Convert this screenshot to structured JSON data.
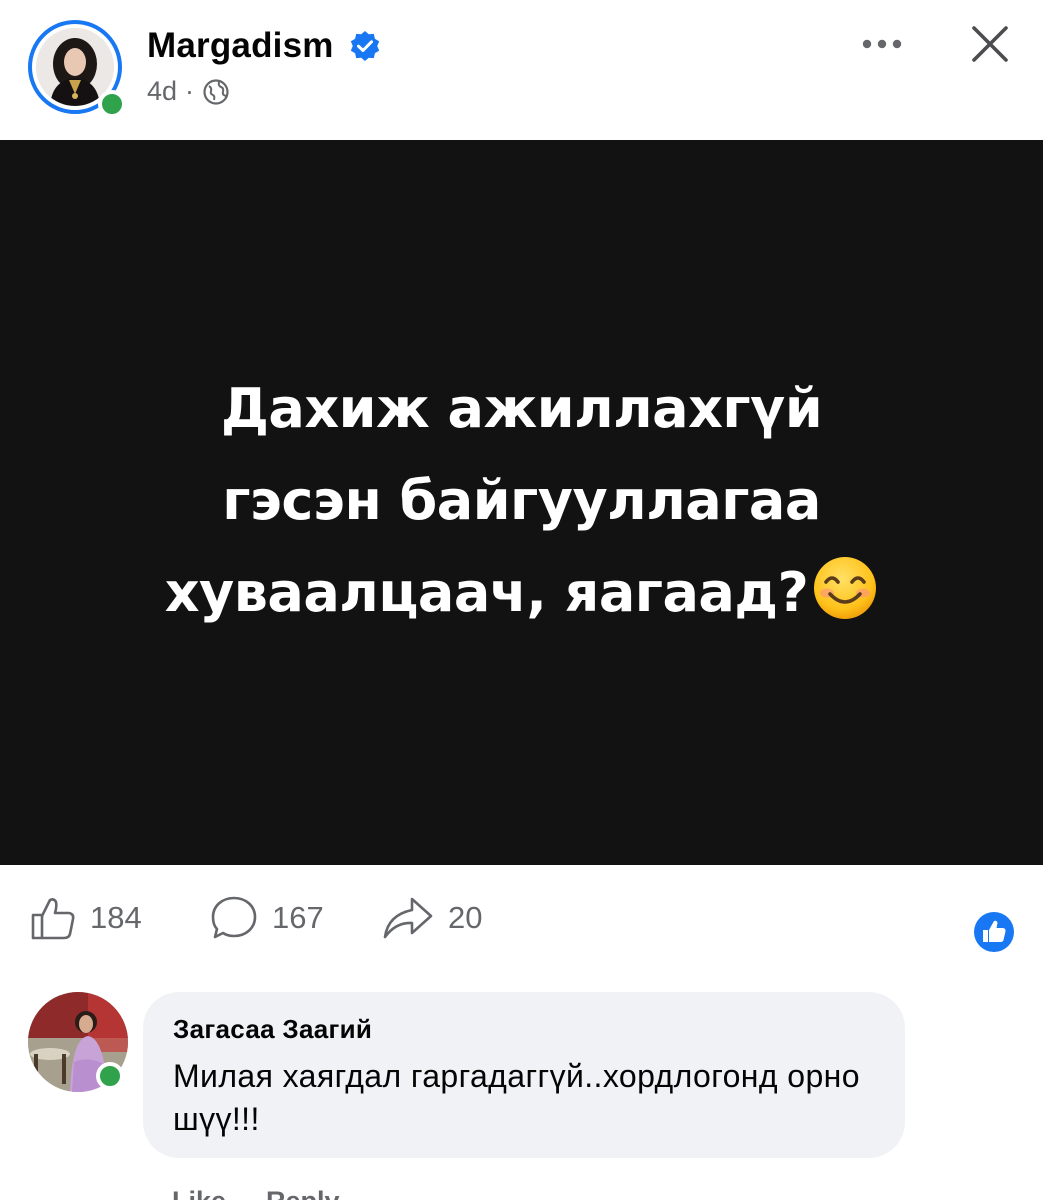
{
  "post": {
    "author_name": "Margadism",
    "verified_icon": "verified-badge-icon",
    "time_ago": "4d",
    "separator": "·",
    "audience_icon": "globe-icon",
    "more_icon": "more-horizontal-icon",
    "close_icon": "close-icon",
    "image_text": {
      "line1": "Дахиж ажиллахгүй",
      "line2": "гэсэн байгууллагаа",
      "line3": "хуваалцаач, яагаад?"
    },
    "emoji": "smiling-face-emoji",
    "background_color": "#121212"
  },
  "actions": {
    "like_count": "184",
    "comment_count": "167",
    "share_count": "20"
  },
  "comment": {
    "author_name": "Загасаа Заагий",
    "text": "Милая хаягдал гаргадаггүй..хордлогонд орно шүү!!!",
    "actions": {
      "like_label": "Like",
      "reply_label": "Reply"
    }
  },
  "colors": {
    "accent": "#1877f2",
    "online": "#31a24c",
    "secondary_text": "#65676b",
    "bubble": "#f0f2f5"
  }
}
